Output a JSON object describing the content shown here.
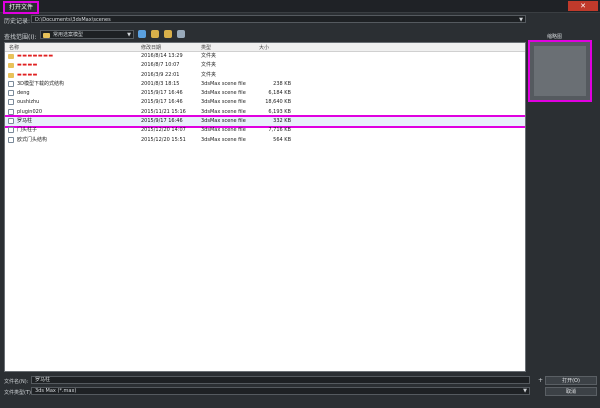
{
  "window": {
    "title": "打开文件",
    "close_glyph": "✕"
  },
  "history": {
    "label": "历史记录:",
    "path": "D:\\Documents\\3dsMax\\scenes"
  },
  "look_in": {
    "label": "查找范围(I):",
    "value": "常用选案模型"
  },
  "columns": {
    "name": "名称",
    "date": "修改日期",
    "type": "类型",
    "size": "大小"
  },
  "files": [
    {
      "name": "▬▬▬▬▬▬▬",
      "date": "2016/8/14 13:29",
      "type": "文件夹",
      "size": "",
      "icon": "folder-icon",
      "redacted": true
    },
    {
      "name": "▬▬▬▬",
      "date": "2016/8/7 10:07",
      "type": "文件夹",
      "size": "",
      "icon": "folder-icon",
      "redacted": true
    },
    {
      "name": "▬▬▬▬",
      "date": "2016/3/9 22:01",
      "type": "文件夹",
      "size": "",
      "icon": "folder-icon",
      "redacted": true
    },
    {
      "name": "3D模型下载的式结构",
      "date": "2001/8/3 18:15",
      "type": "3dsMax scene file",
      "size": "238 KB",
      "icon": "max-file-icon",
      "redacted": false
    },
    {
      "name": "deng",
      "date": "2015/9/17 16:46",
      "type": "3dsMax scene file",
      "size": "6,184 KB",
      "icon": "max-file-icon",
      "redacted": false
    },
    {
      "name": "oushizhu",
      "date": "2015/9/17 16:46",
      "type": "3dsMax scene file",
      "size": "18,640 KB",
      "icon": "max-file-icon",
      "redacted": false
    },
    {
      "name": "plugin020",
      "date": "2015/11/21 15:16",
      "type": "3dsMax scene file",
      "size": "6,193 KB",
      "icon": "max-file-icon",
      "redacted": false
    },
    {
      "name": "罗马柱",
      "date": "2015/9/17 16:46",
      "type": "3dsMax scene file",
      "size": "332 KB",
      "icon": "max-file-icon",
      "redacted": false,
      "selected": true
    },
    {
      "name": "门头柱子",
      "date": "2015/12/20 14:07",
      "type": "3dsMax scene file",
      "size": "7,716 KB",
      "icon": "max-file-icon",
      "redacted": false
    },
    {
      "name": "欧式门头结构",
      "date": "2015/12/20 15:51",
      "type": "3dsMax scene file",
      "size": "564 KB",
      "icon": "max-file-icon",
      "redacted": false
    }
  ],
  "preview": {
    "label": "缩略图"
  },
  "file_name": {
    "label": "文件名(N):",
    "value": "罗马柱"
  },
  "file_type": {
    "label": "文件类型(T):",
    "value": "3ds Max (*.max)"
  },
  "buttons": {
    "open": "打开(O)",
    "cancel": "取消",
    "plus": "+"
  },
  "colors": {
    "highlight": "#e000e0",
    "background": "#2b2f33",
    "list_bg": "#ffffff"
  }
}
